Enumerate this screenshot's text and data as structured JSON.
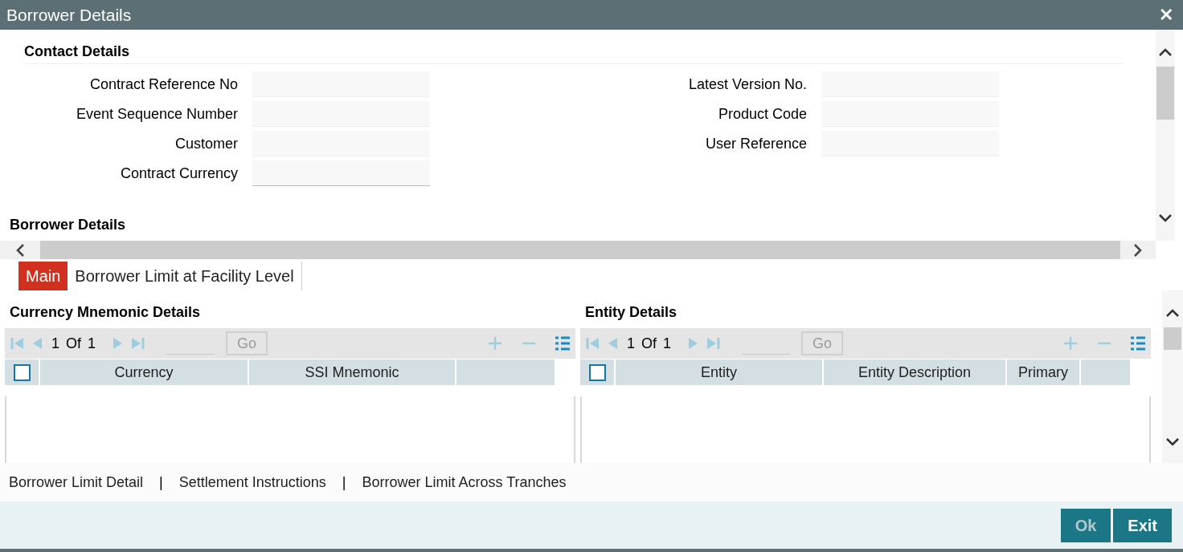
{
  "window": {
    "title": "Borrower Details",
    "close": "✕"
  },
  "contact_details": {
    "title": "Contact Details",
    "fields_left": [
      {
        "label": "Contract Reference No",
        "underlined": false
      },
      {
        "label": "Event Sequence Number",
        "underlined": false
      },
      {
        "label": "Customer",
        "underlined": false
      },
      {
        "label": "Contract Currency",
        "underlined": true
      }
    ],
    "fields_right": [
      {
        "label": "Latest Version No.",
        "underlined": false
      },
      {
        "label": "Product Code",
        "underlined": false
      },
      {
        "label": "User Reference",
        "underlined": false
      }
    ]
  },
  "borrower_details": {
    "title": "Borrower Details"
  },
  "tabs": [
    {
      "label": "Main",
      "selected": true
    },
    {
      "label": "Borrower Limit at Facility Level",
      "selected": false
    }
  ],
  "grids": [
    {
      "title": "Currency Mnemonic Details",
      "page": "1",
      "of": "Of",
      "total": "1",
      "go": "Go",
      "checked": false,
      "columns": [
        "Currency",
        "SSI Mnemonic"
      ]
    },
    {
      "title": "Entity Details",
      "page": "1",
      "of": "Of",
      "total": "1",
      "go": "Go",
      "checked": false,
      "columns": [
        "Entity",
        "Entity Description",
        "Primary"
      ]
    }
  ],
  "footer_links": [
    "Borrower Limit Detail",
    "Settlement Instructions",
    "Borrower Limit Across Tranches"
  ],
  "separator": "|",
  "buttons": [
    {
      "label": "Ok",
      "disabled": true
    },
    {
      "label": "Exit",
      "disabled": false
    }
  ]
}
